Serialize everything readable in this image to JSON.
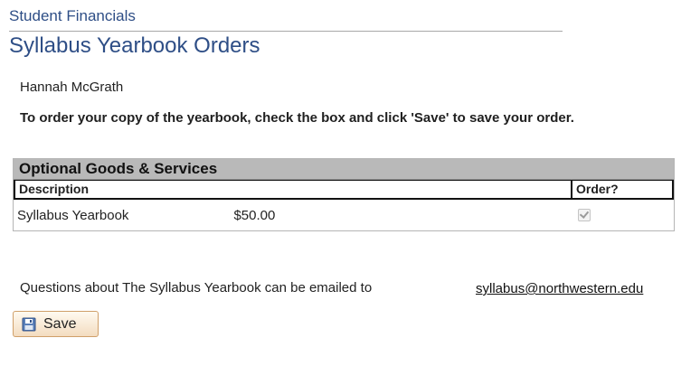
{
  "header": {
    "breadcrumb": "Student Financials",
    "title": "Syllabus Yearbook Orders"
  },
  "student": {
    "name": "Hannah McGrath"
  },
  "instructions": "To order your copy of the yearbook, check the box and click 'Save'  to save your order.",
  "grid": {
    "caption": "Optional Goods & Services",
    "columns": {
      "description": "Description",
      "order": "Order?"
    },
    "rows": [
      {
        "description": "Syllabus Yearbook",
        "amount": "$50.00",
        "ordered": true
      }
    ]
  },
  "footer": {
    "question": "Questions about The Syllabus Yearbook can be emailed to",
    "email": "syllabus@northwestern.edu"
  },
  "actions": {
    "save_label": "Save"
  },
  "colors": {
    "heading": "#2e4e86",
    "caption_bg": "#b9b9b9",
    "button_border": "#d0a06a"
  },
  "icons": {
    "save": "floppy-disk-icon",
    "checkbox": "check-icon"
  }
}
